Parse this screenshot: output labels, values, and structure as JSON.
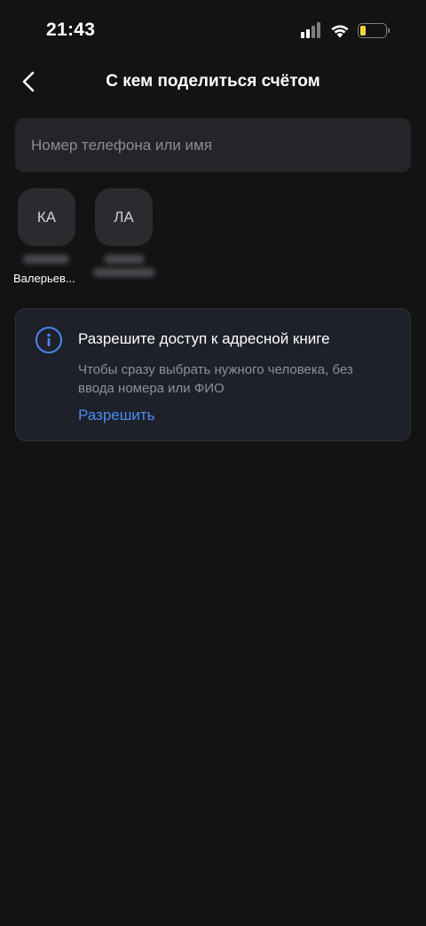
{
  "status_bar": {
    "time": "21:43",
    "battery_color": "#f6d53b"
  },
  "header": {
    "title": "С кем поделиться счётом",
    "back_icon": "chevron-left-icon"
  },
  "search": {
    "placeholder": "Номер телефона или имя",
    "value": ""
  },
  "contacts": [
    {
      "initials": "КА",
      "name_visible": "Валерьев..."
    },
    {
      "initials": "ЛА",
      "name_visible": ""
    }
  ],
  "info_card": {
    "icon": "info-icon",
    "title": "Разрешите доступ к адресной книге",
    "text": "Чтобы сразу выбрать нужного человека, без ввода номера или ФИО",
    "action_label": "Разрешить",
    "accent_color": "#4b8cf5"
  }
}
